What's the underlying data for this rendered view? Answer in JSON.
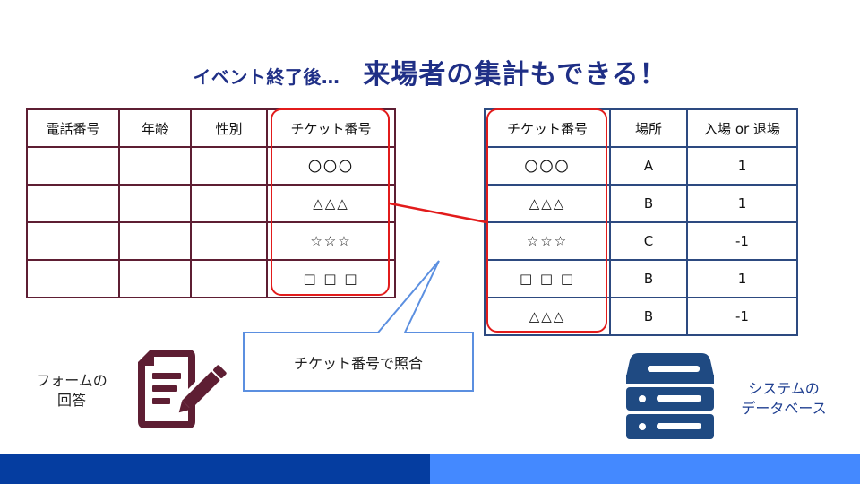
{
  "title": {
    "small": "イベント終了後…",
    "big": "来場者の集計もできる！"
  },
  "form_table": {
    "headers": [
      "電話番号",
      "年齢",
      "性別",
      "チケット番号"
    ],
    "rows": [
      [
        "",
        "",
        "",
        "〇〇〇"
      ],
      [
        "",
        "",
        "",
        "△△△"
      ],
      [
        "",
        "",
        "",
        "☆☆☆"
      ],
      [
        "",
        "",
        "",
        "□ □ □"
      ]
    ]
  },
  "system_table": {
    "headers": [
      "チケット番号",
      "場所",
      "入場 or 退場"
    ],
    "rows": [
      [
        "〇〇〇",
        "A",
        "1"
      ],
      [
        "△△△",
        "B",
        "1"
      ],
      [
        "☆☆☆",
        "C",
        "-1"
      ],
      [
        "□ □ □",
        "B",
        "1"
      ],
      [
        "△△△",
        "B",
        "-1"
      ]
    ]
  },
  "callout": {
    "text": "チケット番号で照合"
  },
  "captions": {
    "form_line1": "フォームの",
    "form_line2": "回答",
    "db_line1": "システムの",
    "db_line2": "データベース"
  },
  "colors": {
    "title": "#1f2f86",
    "form_border": "#5e1e33",
    "system_border": "#2d4a80",
    "highlight": "#e21b1b",
    "callout_border": "#5b8fe0",
    "footer_left": "#053da0",
    "footer_right": "#4489ff"
  },
  "icons": {
    "form": "document-pen-icon",
    "database": "server-stack-icon"
  }
}
